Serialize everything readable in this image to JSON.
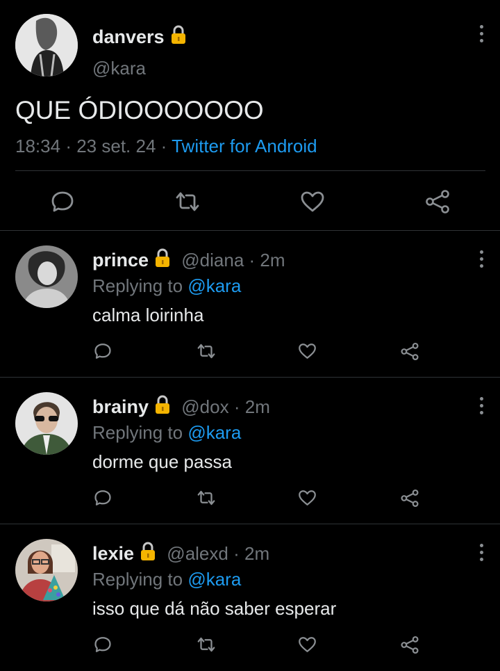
{
  "main_tweet": {
    "display_name": "danvers",
    "handle": "@kara",
    "text": "QUE ÓDIOOOOOOO",
    "time": "18:34",
    "date": "23 set. 24",
    "sep": "·",
    "source": "Twitter for Android"
  },
  "replies": [
    {
      "display_name": "prince",
      "handle": "@diana",
      "time_sep": "·",
      "time": "2m",
      "replying_prefix": "Replying to",
      "replying_handle": "@kara",
      "text": "calma loirinha"
    },
    {
      "display_name": "brainy",
      "handle": "@dox",
      "time_sep": "·",
      "time": "2m",
      "replying_prefix": "Replying to",
      "replying_handle": "@kara",
      "text": "dorme que passa"
    },
    {
      "display_name": "lexie",
      "handle": "@alexd",
      "time_sep": "·",
      "time": "2m",
      "replying_prefix": "Replying to",
      "replying_handle": "@kara",
      "text": "isso que dá não saber esperar"
    }
  ],
  "icons": {
    "lock": "lock-icon",
    "menu": "more-vertical-icon",
    "reply": "comment-icon",
    "retweet": "retweet-icon",
    "like": "heart-icon",
    "share": "share-icon"
  },
  "colors": {
    "background": "#000000",
    "text": "#e7e9ea",
    "secondary": "#71767b",
    "accent": "#1d9bf0",
    "lock": "#f4b400"
  }
}
